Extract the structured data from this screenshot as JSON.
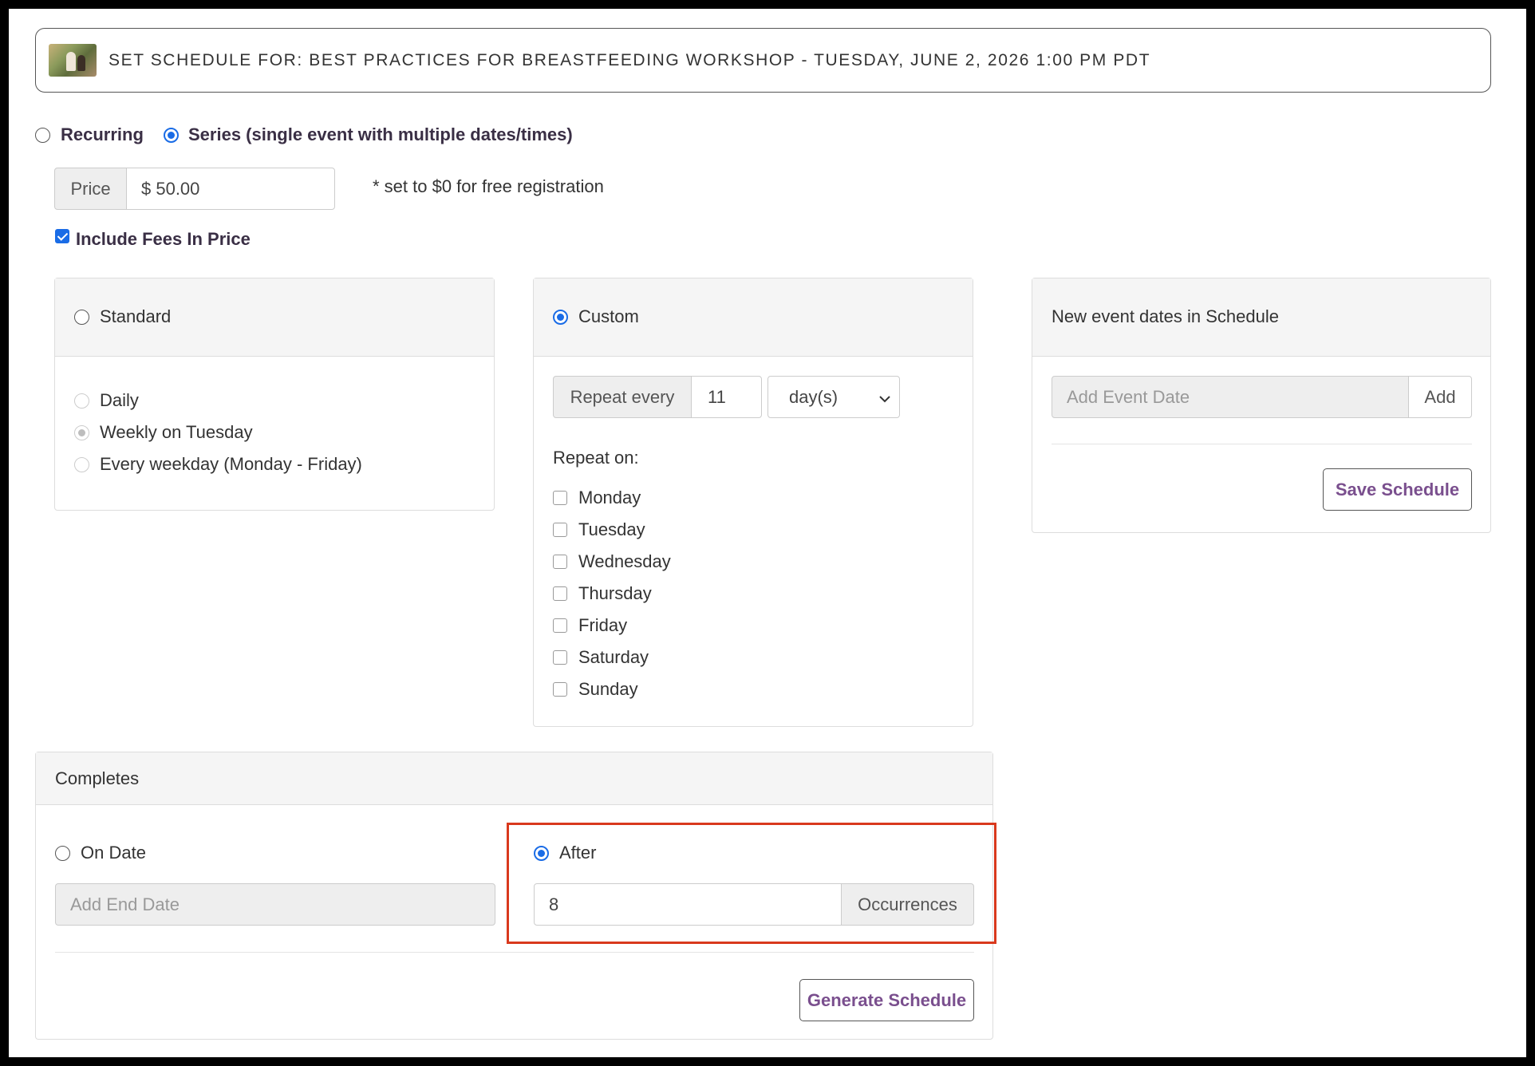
{
  "header": {
    "title": "SET SCHEDULE FOR: BEST PRACTICES FOR BREASTFEEDING WORKSHOP - TUESDAY, JUNE 2, 2026 1:00 PM PDT"
  },
  "schedule_type": {
    "recurring_label": "Recurring",
    "series_label": "Series (single event with multiple dates/times)",
    "selected": "series"
  },
  "price": {
    "label": "Price",
    "value": "$ 50.00",
    "hint": "* set to $0 for free registration"
  },
  "include_fees": {
    "label": "Include Fees In Price",
    "checked": true
  },
  "standard": {
    "label": "Standard",
    "options": [
      "Daily",
      "Weekly on Tuesday",
      "Every weekday (Monday - Friday)"
    ],
    "selected_option": "Weekly on Tuesday"
  },
  "custom": {
    "label": "Custom",
    "repeat_every_label": "Repeat every",
    "repeat_every_value": "11",
    "unit_value": "day(s)",
    "repeat_on_label": "Repeat on:",
    "days": [
      "Monday",
      "Tuesday",
      "Wednesday",
      "Thursday",
      "Friday",
      "Saturday",
      "Sunday"
    ]
  },
  "new_dates": {
    "title": "New event dates in Schedule",
    "add_placeholder": "Add Event Date",
    "add_label": "Add",
    "save_label": "Save Schedule"
  },
  "completes": {
    "title": "Completes",
    "on_date_label": "On Date",
    "end_date_placeholder": "Add End Date",
    "after_label": "After",
    "occurrences_value": "8",
    "occurrences_label": "Occurrences",
    "generate_label": "Generate Schedule",
    "selected": "after"
  },
  "colors": {
    "accent": "#1a6ce6",
    "button_text": "#7a4f8e",
    "highlight": "#d9391d"
  }
}
